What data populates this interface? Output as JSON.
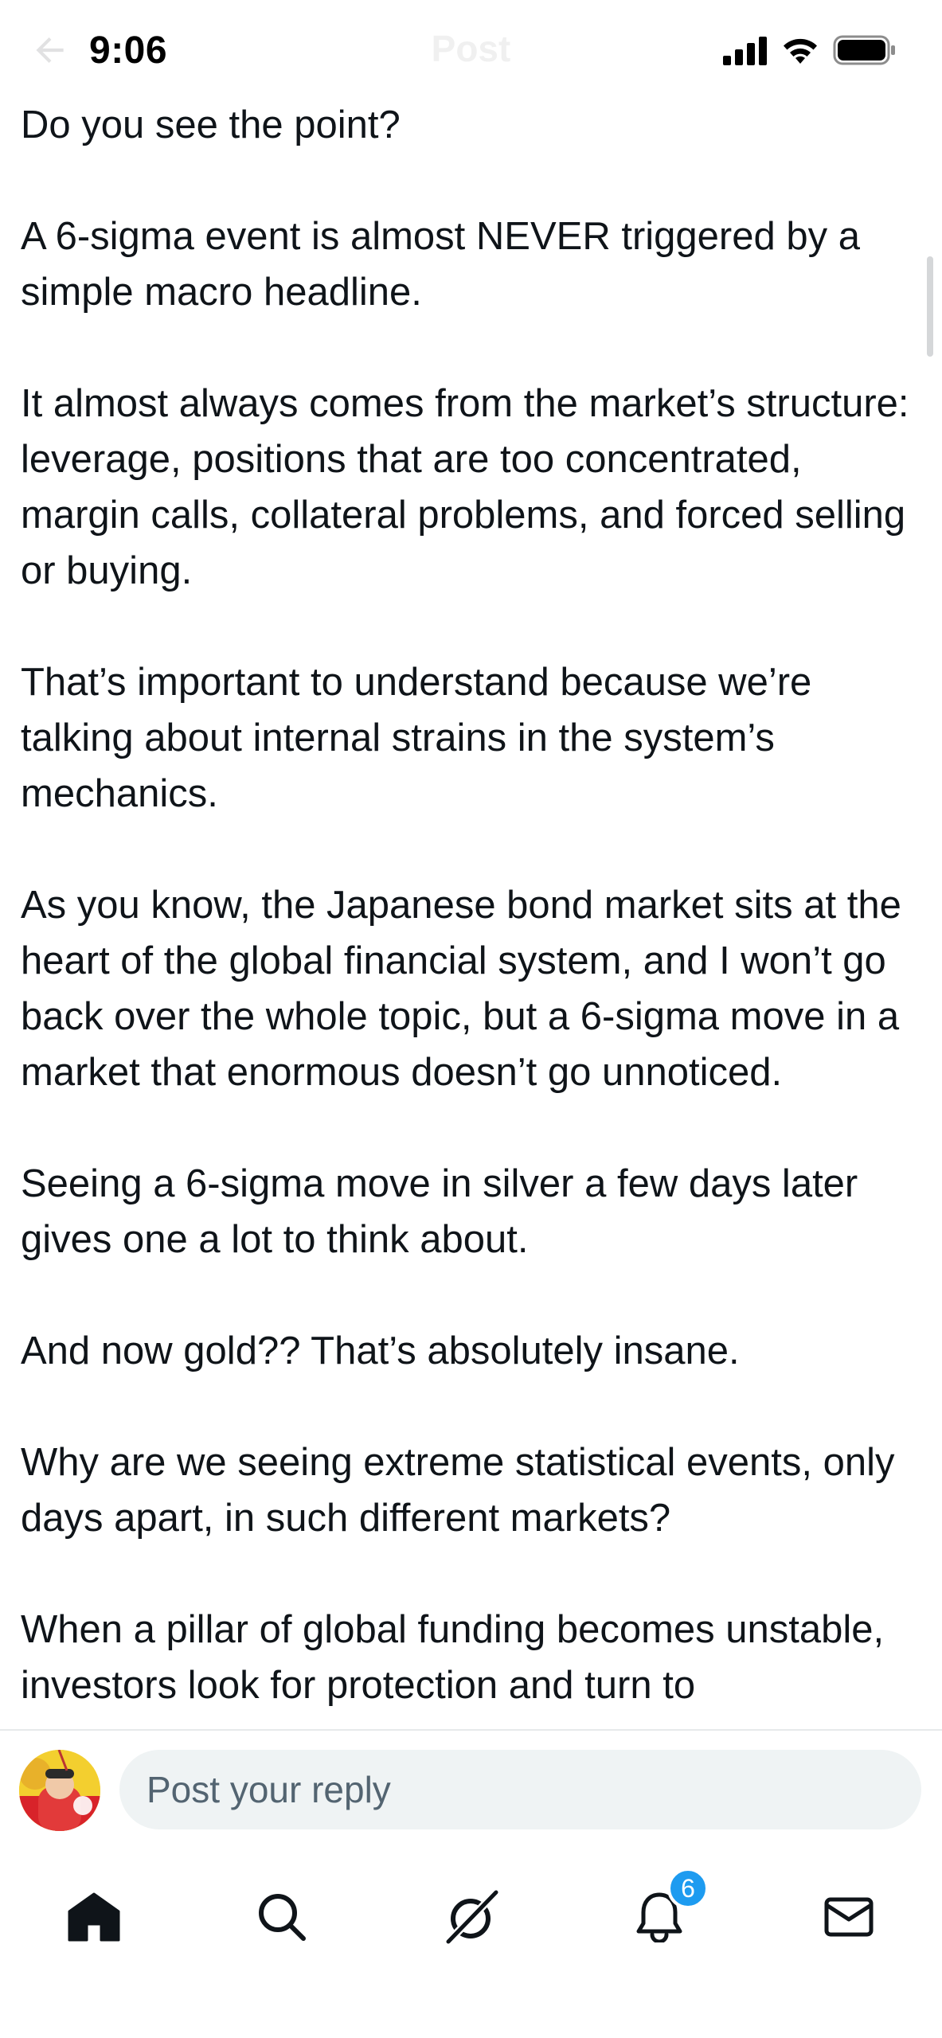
{
  "status_bar": {
    "time": "9:06",
    "header_title": "Post"
  },
  "post": {
    "paragraphs": [
      "Do you see the point?",
      "A 6-sigma event is almost NEVER triggered by a simple macro headline.",
      "It almost always comes from the market’s structure: leverage, positions that are too concentrated, margin calls, collateral problems, and forced selling or buying.",
      "That’s important to understand because we’re talking about internal strains in the system’s mechanics.",
      "As you know, the Japanese bond market sits at the heart of the global financial system, and I won’t go back over the whole topic, but a 6-sigma move in a market that enormous doesn’t go unnoticed.",
      "Seeing a 6-sigma move in silver a few days later gives one a lot to think about.",
      "And now gold?? That’s absolutely insane.",
      "Why are we seeing extreme statistical events, only days apart, in such different markets?",
      "When a pillar of global funding becomes unstable, investors look for protection and turn to"
    ]
  },
  "reply": {
    "placeholder": "Post your reply"
  },
  "nav": {
    "items": [
      "home-icon",
      "search-icon",
      "grok-icon",
      "notifications-icon",
      "messages-icon"
    ],
    "notification_count": "6"
  },
  "colors": {
    "text": "#0f1419",
    "accent": "#1d9bf0",
    "input_bg": "#eff3f4",
    "placeholder": "#536471"
  }
}
